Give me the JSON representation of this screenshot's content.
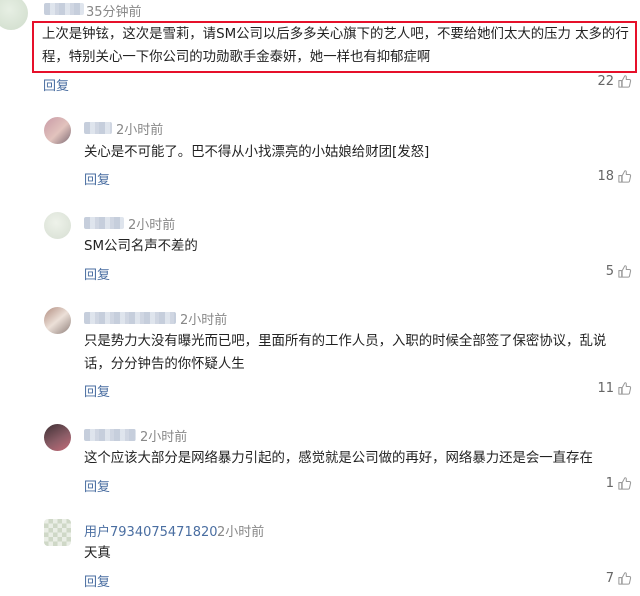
{
  "main_comment": {
    "time": "35分钟前",
    "text": "上次是钟铉，这次是雪莉，请SM公司以后多多关心旗下的艺人吧，不要给她们太大的压力 太多的行程，特别关心一下你公司的功勋歌手金泰妍，她一样也有抑郁症啊",
    "reply_label": "回复",
    "likes": "22"
  },
  "replies": [
    {
      "time": "2小时前",
      "text": "关心是不可能了。巴不得从小找漂亮的小姑娘给财团[发怒]",
      "reply_label": "回复",
      "likes": "18"
    },
    {
      "time": "2小时前",
      "text": "SM公司名声不差的",
      "reply_label": "回复",
      "likes": "5"
    },
    {
      "time": "2小时前",
      "text": "只是势力大没有曝光而已吧，里面所有的工作人员，入职的时候全部签了保密协议，乱说话，分分钟告的你怀疑人生",
      "reply_label": "回复",
      "likes": "11"
    },
    {
      "time": "2小时前",
      "text": "这个应该大部分是网络暴力引起的，感觉就是公司做的再好，网络暴力还是会一直存在",
      "reply_label": "回复",
      "likes": "1"
    },
    {
      "username": "用户7934075471820",
      "time": "2小时前",
      "text": "天真",
      "reply_label": "回复",
      "likes": "7"
    }
  ],
  "colors": {
    "highlight_border": "#e6102a",
    "link": "#4a6ea1",
    "meta": "#888888"
  },
  "icons": {
    "like": "thumbs-up-icon"
  }
}
